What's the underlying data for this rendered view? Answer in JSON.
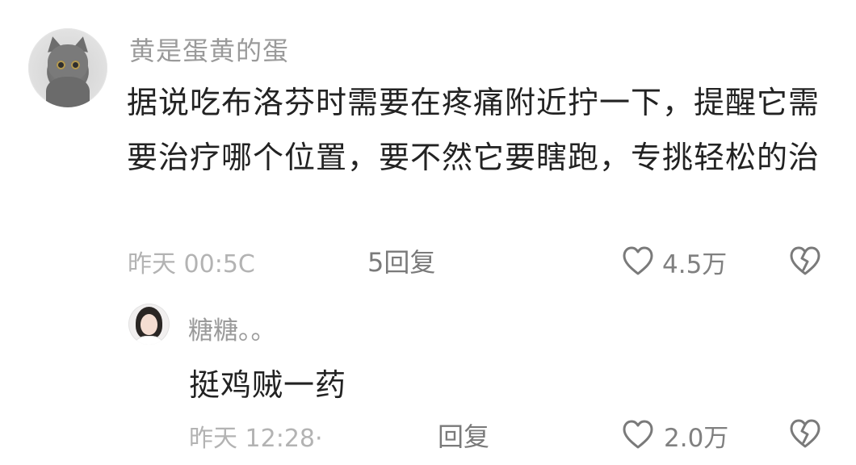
{
  "main_comment": {
    "username": "黄是蛋黄的蛋",
    "text": "据说吃布洛芬时需要在疼痛附近拧一下，提醒它需要治疗哪个位置，要不然它要瞎跑，专挑轻松的治",
    "time": "昨天 00:5C",
    "reply_label": "5回复",
    "like_count": "4.5万",
    "icons": {
      "avatar": "cat-avatar",
      "like": "heart-icon",
      "dislike": "broken-heart-icon"
    }
  },
  "reply_comment": {
    "username": "糖糖。。",
    "text": "挺鸡贼一药",
    "time": "昨天 12:28·",
    "reply_label": "回复",
    "like_count": "2.0万",
    "icons": {
      "avatar": "girl-avatar",
      "like": "heart-icon",
      "dislike": "broken-heart-icon"
    }
  }
}
